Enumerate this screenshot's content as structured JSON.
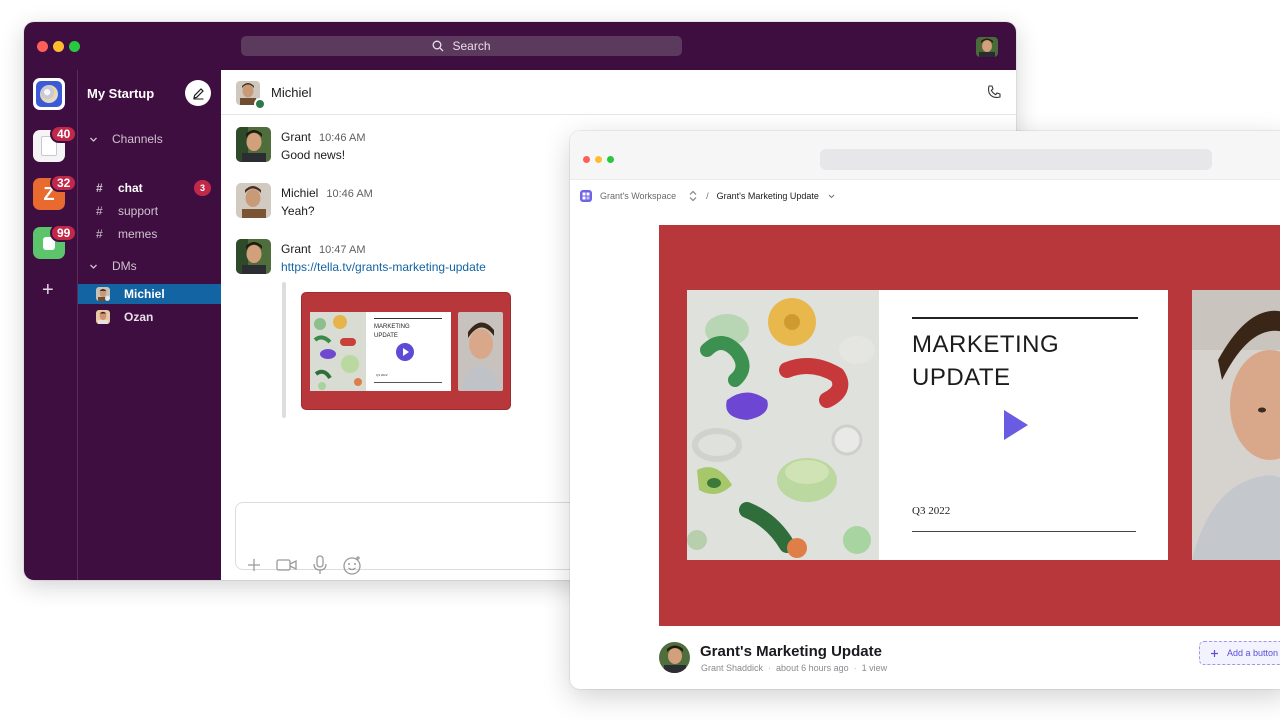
{
  "slack": {
    "search_placeholder": "Search",
    "workspace_name": "My Startup",
    "rail": {
      "badges": [
        "40",
        "32",
        "99"
      ],
      "z_letter": "Z",
      "add_label": "+"
    },
    "sections": {
      "channels_label": "Channels",
      "dms_label": "DMs"
    },
    "channels": [
      {
        "name": "chat",
        "badge": "3"
      },
      {
        "name": "support"
      },
      {
        "name": "memes"
      }
    ],
    "dms": [
      {
        "name": "Michiel"
      },
      {
        "name": "Ozan"
      }
    ],
    "conversation": {
      "title": "Michiel",
      "messages": [
        {
          "author": "Grant",
          "time": "10:46 AM",
          "text": "Good news!"
        },
        {
          "author": "Michiel",
          "time": "10:46 AM",
          "text": "Yeah?"
        },
        {
          "author": "Grant",
          "time": "10:47 AM",
          "text": "https://tella.tv/grants-marketing-update"
        }
      ],
      "preview": {
        "slide_title": "MARKETING UPDATE",
        "slide_quarter": "Q3 2022"
      }
    }
  },
  "tella": {
    "breadcrumb": {
      "workspace": "Grant's Workspace",
      "separator": "/",
      "current": "Grant's Marketing Update"
    },
    "slide": {
      "title_line1": "MARKETING",
      "title_line2": "UPDATE",
      "quarter": "Q3 2022"
    },
    "video": {
      "title": "Grant's Marketing Update",
      "author": "Grant Shaddick",
      "time_ago": "about 6 hours ago",
      "views": "1 view",
      "add_button": "Add a button"
    }
  },
  "colors": {
    "slack_aubergine": "#3f0e40",
    "selection_blue": "#1264a3",
    "badge_red": "#c2284a",
    "stage_red": "#b7373a",
    "play_purple": "#6a5ce2"
  }
}
